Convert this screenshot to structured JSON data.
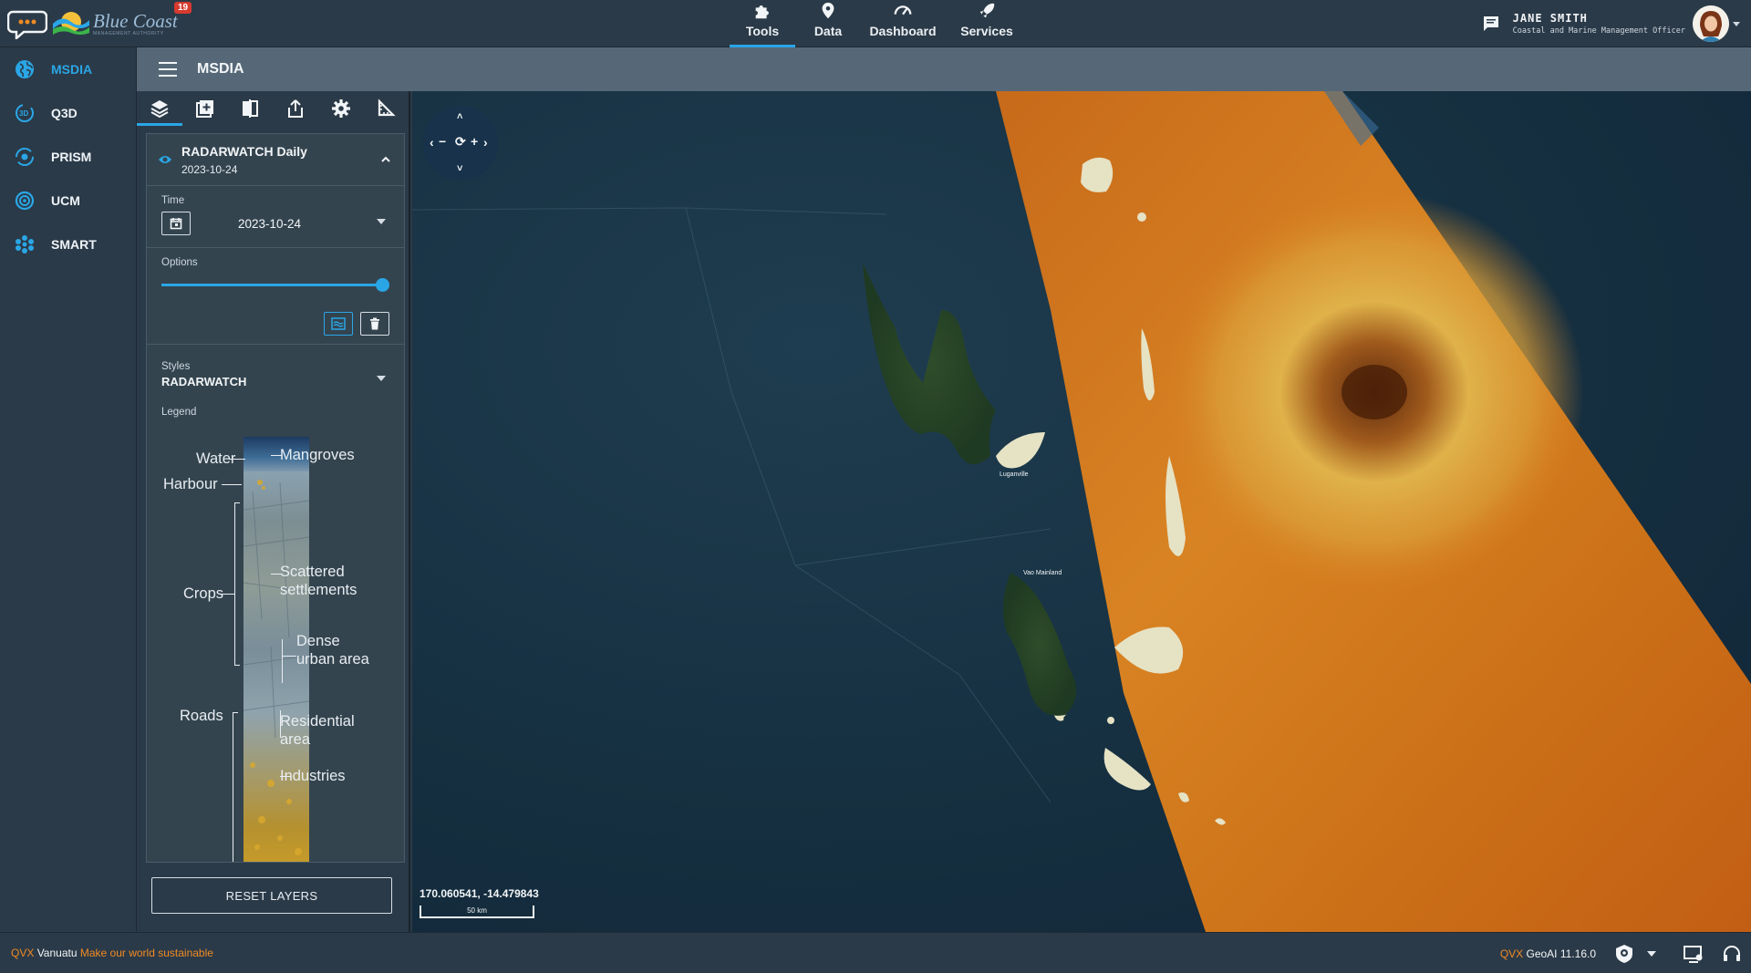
{
  "app": {
    "brand_name": "Blue Coast",
    "brand_subtitle": "MANAGEMENT AUTHORITY",
    "notification_count": "19"
  },
  "topnav": {
    "items": [
      {
        "label": "Tools",
        "icon": "puzzle-icon",
        "active": true
      },
      {
        "label": "Data",
        "icon": "map-pin-icon"
      },
      {
        "label": "Dashboard",
        "icon": "gauge-icon"
      },
      {
        "label": "Services",
        "icon": "rocket-icon"
      }
    ]
  },
  "user": {
    "name": "JANE SMITH",
    "role": "Coastal and Marine Management Officer"
  },
  "sidebar": {
    "items": [
      {
        "label": "MSDIA",
        "icon": "globe-icon",
        "active": true
      },
      {
        "label": "Q3D",
        "icon": "3d-icon"
      },
      {
        "label": "PRISM",
        "icon": "prism-icon"
      },
      {
        "label": "UCM",
        "icon": "ucm-icon"
      },
      {
        "label": "SMART",
        "icon": "smart-icon"
      }
    ]
  },
  "subheader": {
    "title": "MSDIA"
  },
  "panel": {
    "tabs": [
      "layers-icon",
      "add-layer-icon",
      "compare-icon",
      "share-icon",
      "settings-icon",
      "measure-icon"
    ],
    "layer": {
      "name": "RADARWATCH Daily",
      "date": "2023-10-24"
    },
    "time": {
      "label": "Time",
      "value": "2023-10-24"
    },
    "options": {
      "label": "Options",
      "opacity": 1.0
    },
    "styles": {
      "label": "Styles",
      "value": "RADARWATCH"
    },
    "legend": {
      "label": "Legend",
      "items_left": [
        "Water",
        "Harbour",
        "Crops",
        "Roads"
      ],
      "items_right": [
        "Mangroves",
        "Scattered settlements",
        "Dense urban area",
        "Residential area",
        "Industries"
      ]
    },
    "reset_label": "RESET LAYERS"
  },
  "map": {
    "coordinates": "170.060541, -14.479843",
    "scale_label": "50 km",
    "place_labels": [
      "Luganville",
      "Vao Mainland"
    ]
  },
  "footer": {
    "left_brand": "QVX",
    "left_place": "Vanuatu",
    "left_slogan": "Make our world sustainable",
    "right_brand": "QVX",
    "right_version": "GeoAI 11.16.0"
  },
  "colors": {
    "accent": "#2aa6e6",
    "brand_orange": "#f08a24",
    "background": "#2b3a48"
  }
}
